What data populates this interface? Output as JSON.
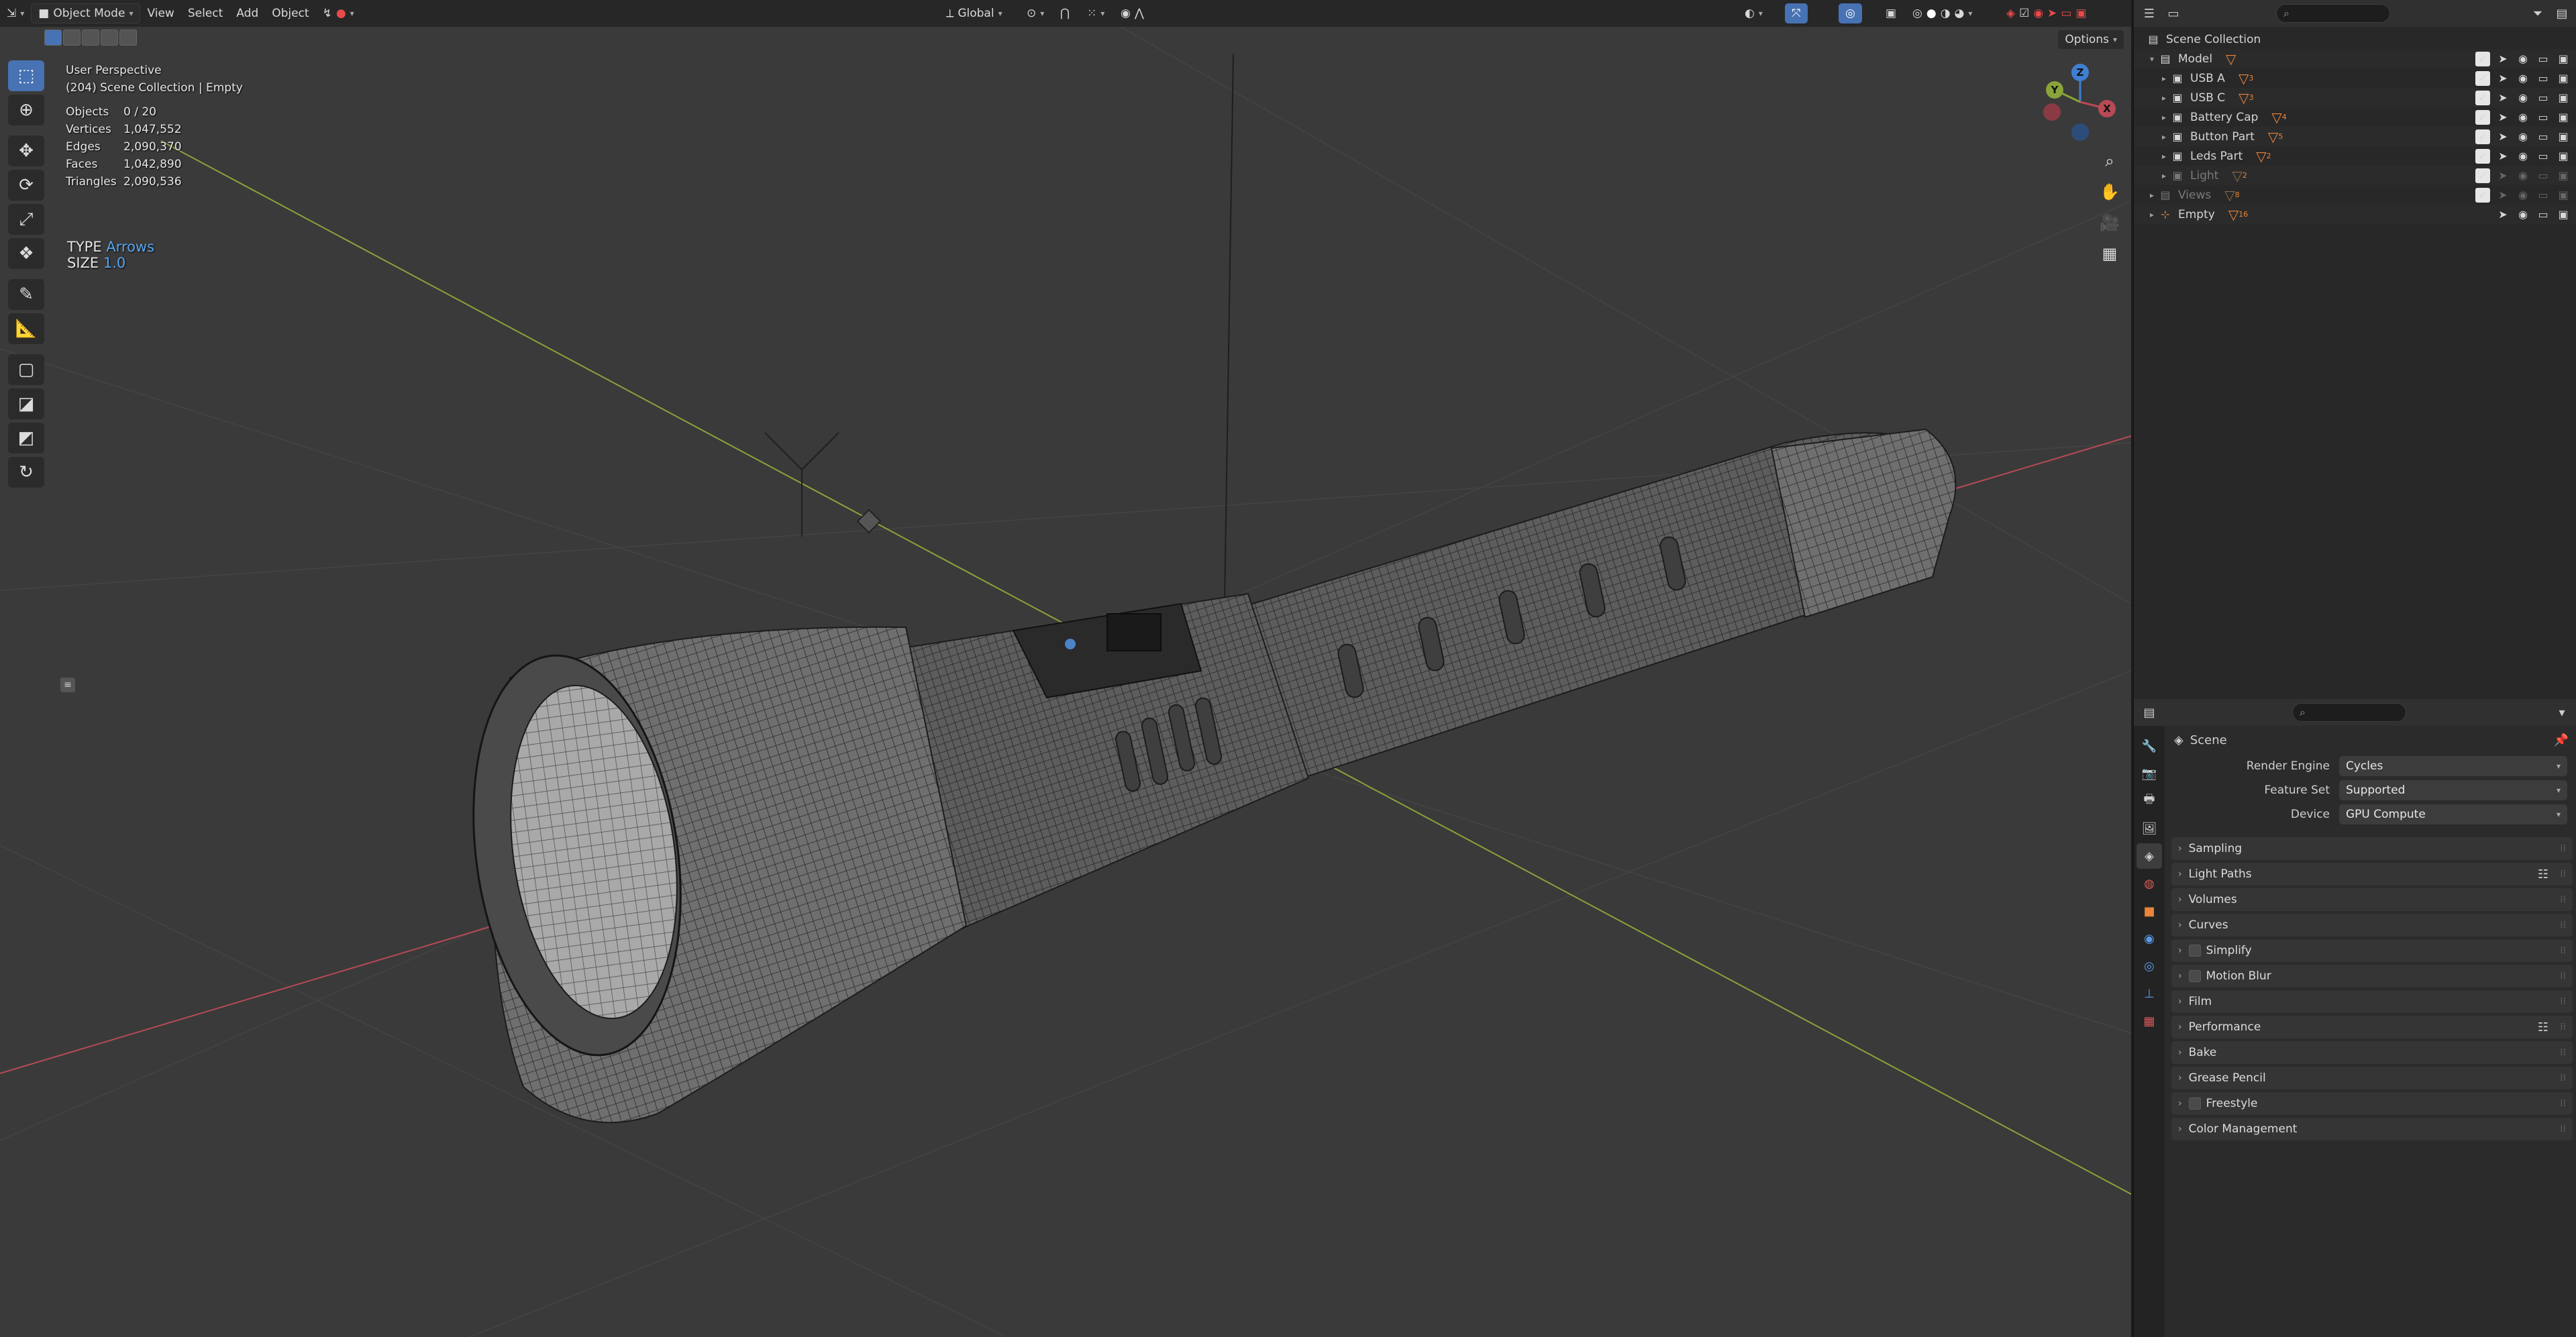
{
  "header": {
    "mode_label": "Object Mode",
    "menus": [
      "View",
      "Select",
      "Add",
      "Object"
    ],
    "orientation_label": "Global",
    "options_label": "Options"
  },
  "viewport": {
    "title": "User Perspective",
    "subtitle": "(204) Scene Collection | Empty",
    "stats": [
      {
        "key": "Objects",
        "value": "0 / 20"
      },
      {
        "key": "Vertices",
        "value": "1,047,552"
      },
      {
        "key": "Edges",
        "value": "2,090,370"
      },
      {
        "key": "Faces",
        "value": "1,042,890"
      },
      {
        "key": "Triangles",
        "value": "2,090,536"
      }
    ],
    "type_label": "TYPE",
    "type_value": "Arrows",
    "size_label": "SIZE",
    "size_value": "1.0",
    "gizmo": {
      "x": "X",
      "y": "Y",
      "z": "Z"
    },
    "colors": {
      "x_axis": "#b84a56",
      "y_axis": "#8aa33a",
      "z_axis": "#3f7fd1",
      "background": "#3a3a3a",
      "active": "#4772b3"
    }
  },
  "outliner": {
    "root": "Scene Collection",
    "items": [
      {
        "label": "Model",
        "count": "",
        "level": 1,
        "icon": "collection-icon",
        "dim": false
      },
      {
        "label": "USB A",
        "count": "3",
        "level": 2,
        "icon": "object-icon",
        "dim": false
      },
      {
        "label": "USB C",
        "count": "3",
        "level": 2,
        "icon": "object-icon",
        "dim": false
      },
      {
        "label": "Battery Cap",
        "count": "4",
        "level": 2,
        "icon": "object-icon",
        "dim": false
      },
      {
        "label": "Button Part",
        "count": "5",
        "level": 2,
        "icon": "object-icon",
        "dim": false
      },
      {
        "label": "Leds Part",
        "count": "2",
        "level": 2,
        "icon": "object-icon",
        "dim": false
      },
      {
        "label": "Light",
        "count": "2",
        "level": 2,
        "icon": "object-icon",
        "dim": true
      },
      {
        "label": "Views",
        "count": "8",
        "level": 1,
        "icon": "collection-icon",
        "dim": true
      },
      {
        "label": "Empty",
        "count": "16",
        "level": 1,
        "icon": "empty-icon",
        "dim": false
      }
    ]
  },
  "properties": {
    "context": "Scene",
    "render_engine": {
      "label": "Render Engine",
      "value": "Cycles"
    },
    "feature_set": {
      "label": "Feature Set",
      "value": "Supported"
    },
    "device": {
      "label": "Device",
      "value": "GPU Compute"
    },
    "panels": [
      {
        "label": "Sampling",
        "checkbox": false,
        "list": false
      },
      {
        "label": "Light Paths",
        "checkbox": false,
        "list": true
      },
      {
        "label": "Volumes",
        "checkbox": false,
        "list": false
      },
      {
        "label": "Curves",
        "checkbox": false,
        "list": false
      },
      {
        "label": "Simplify",
        "checkbox": true,
        "list": false
      },
      {
        "label": "Motion Blur",
        "checkbox": true,
        "list": false
      },
      {
        "label": "Film",
        "checkbox": false,
        "list": false
      },
      {
        "label": "Performance",
        "checkbox": false,
        "list": true
      },
      {
        "label": "Bake",
        "checkbox": false,
        "list": false
      },
      {
        "label": "Grease Pencil",
        "checkbox": false,
        "list": false
      },
      {
        "label": "Freestyle",
        "checkbox": true,
        "list": false
      },
      {
        "label": "Color Management",
        "checkbox": false,
        "list": false
      }
    ]
  }
}
